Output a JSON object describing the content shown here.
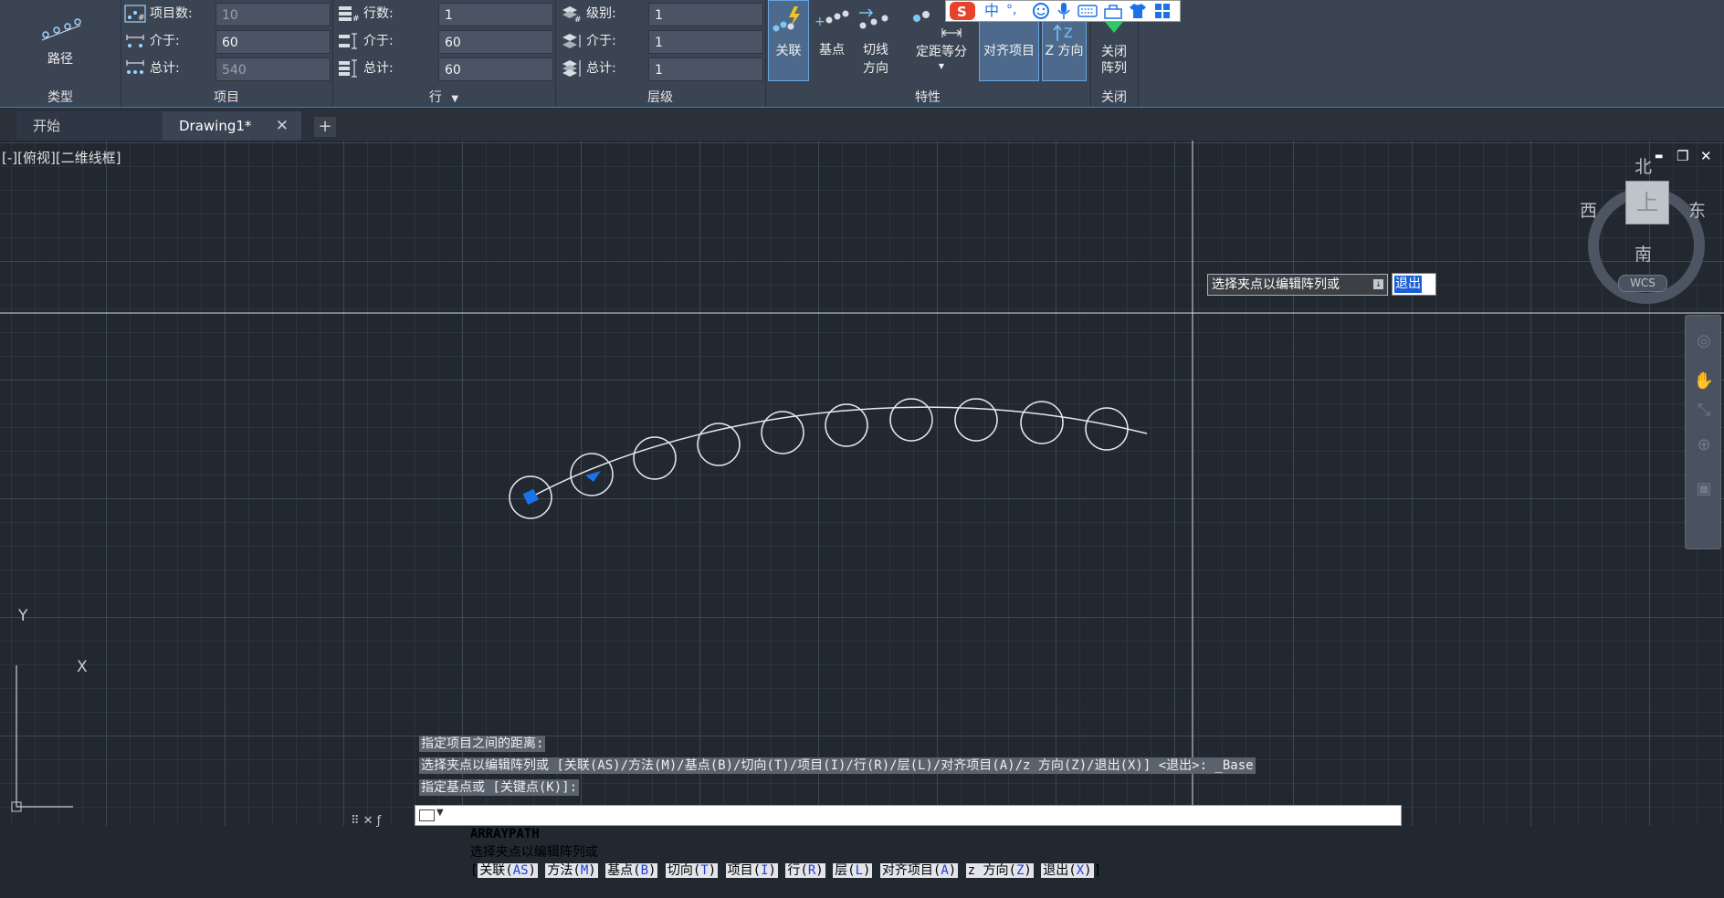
{
  "ribbon": {
    "type_panel": {
      "button": "路径",
      "title": "类型"
    },
    "items_panel": {
      "title": "项目",
      "fields": [
        {
          "label": "项目数:",
          "value": "10"
        },
        {
          "label": "介于:",
          "value": "60"
        },
        {
          "label": "总计:",
          "value": "540"
        }
      ]
    },
    "rows_panel": {
      "title": "行",
      "fields": [
        {
          "label": "行数:",
          "value": "1"
        },
        {
          "label": "介于:",
          "value": "60"
        },
        {
          "label": "总计:",
          "value": "60"
        }
      ]
    },
    "levels_panel": {
      "title": "层级",
      "fields": [
        {
          "label": "级别:",
          "value": "1"
        },
        {
          "label": "介于:",
          "value": "1"
        },
        {
          "label": "总计:",
          "value": "1"
        }
      ]
    },
    "properties_panel": {
      "title": "特性",
      "buttons": {
        "associative": "关联",
        "base_point": "基点",
        "tangent_line1": "切线",
        "tangent_line2": "方向",
        "measure": "定距等分",
        "align_items": "对齐项目",
        "z_direction": "Z 方向"
      }
    },
    "close_panel": {
      "title": "关闭",
      "button_line1": "关闭",
      "button_line2": "阵列"
    },
    "ime_bar": {
      "mode": "中",
      "punct": "°,"
    }
  },
  "tabs": {
    "start": "开始",
    "drawing": "Drawing1*",
    "close": "✕",
    "add": "+"
  },
  "viewport": {
    "label": "[-][俯视][二维线框]",
    "window_controls": {
      "minimize": "▬",
      "restore": "❐",
      "close": "✕"
    },
    "compass": {
      "north": "北",
      "south": "南",
      "east": "东",
      "west": "西",
      "top": "上",
      "wcs": "WCS"
    },
    "ucs": {
      "y": "Y",
      "x": "X"
    },
    "array": {
      "item_count": 10
    }
  },
  "dynamic_input": {
    "prompt": "选择夹点以编辑阵列或",
    "value": "退出"
  },
  "command_history": [
    "指定项目之间的距离:",
    "选择夹点以编辑阵列或 [关联(AS)/方法(M)/基点(B)/切向(T)/项目(I)/行(R)/层(L)/对齐项目(A)/z 方向(Z)/退出(X)] <退出>: _Base",
    "指定基点或 [关键点(K)]:"
  ],
  "command_line": {
    "command": "ARRAYPATH",
    "prompt": "选择夹点以编辑阵列或",
    "options": [
      {
        "name": "关联",
        "key": "AS"
      },
      {
        "name": "方法",
        "key": "M"
      },
      {
        "name": "基点",
        "key": "B"
      },
      {
        "name": "切向",
        "key": "T"
      },
      {
        "name": "项目",
        "key": "I"
      },
      {
        "name": "行",
        "key": "R"
      },
      {
        "name": "层",
        "key": "L"
      },
      {
        "name": "对齐项目",
        "key": "A"
      },
      {
        "name": "z 方向",
        "key": "Z"
      },
      {
        "name": "退出",
        "key": "X"
      }
    ]
  },
  "colors": {
    "accent": "#1a8fc4",
    "grip": "#1a73e8",
    "background": "#212830"
  }
}
